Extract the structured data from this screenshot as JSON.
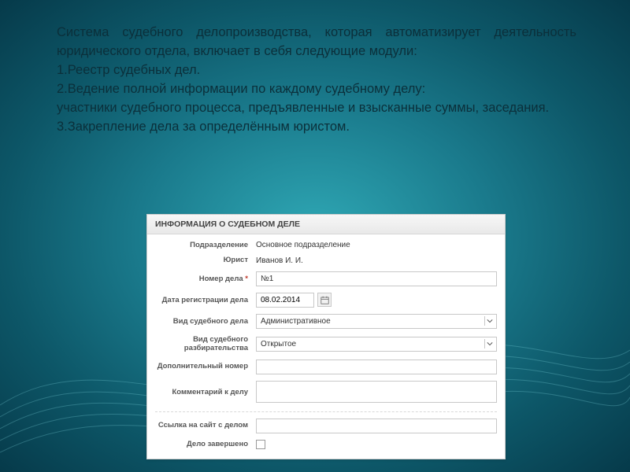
{
  "slide": {
    "intro": "Система судебного делопроизводства, которая автоматизирует деятельность юридического отдела,  включает в себя следующие модули:",
    "item1": "1.Реестр судебных дел.",
    "item2": "2.Ведение полной информации по каждому судебному делу:",
    "item2b": "участники судебного процесса, предъявленные и взысканные суммы, заседания.",
    "item3": "3.Закрепление дела за определённым юристом."
  },
  "form": {
    "header": "ИНФОРМАЦИЯ О СУДЕБНОМ ДЕЛЕ",
    "labels": {
      "department": "Подразделение",
      "lawyer": "Юрист",
      "case_number": "Номер дела",
      "reg_date": "Дата регистрации дела",
      "case_type": "Вид судебного дела",
      "hearing_type": "Вид судебного разбирательства",
      "extra_number": "Дополнительный номер",
      "comment": "Комментарий к делу",
      "site_link": "Ссылка на сайт с делом",
      "completed": "Дело завершено"
    },
    "values": {
      "department": "Основное подразделение",
      "lawyer": "Иванов И. И.",
      "case_number": "№1",
      "reg_date": "08.02.2014",
      "case_type": "Административное",
      "hearing_type": "Открытое",
      "extra_number": "",
      "comment": "",
      "site_link": "",
      "completed": false
    },
    "required_mark": "*"
  }
}
